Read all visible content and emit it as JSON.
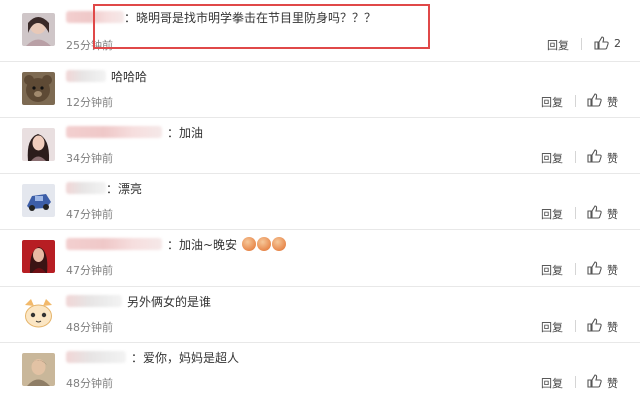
{
  "comments": [
    {
      "text": "：晓明哥是找市明学拳击在节目里防身吗？？？",
      "time": "25分钟前",
      "reply": "回复",
      "like": "2"
    },
    {
      "text": "哈哈哈",
      "time": "12分钟前",
      "reply": "回复",
      "like": "赞"
    },
    {
      "text": "：加油",
      "time": "34分钟前",
      "reply": "回复",
      "like": "赞"
    },
    {
      "text": "：漂亮",
      "time": "47分钟前",
      "reply": "回复",
      "like": "赞"
    },
    {
      "text": "：加油~晚安",
      "time": "47分钟前",
      "reply": "回复",
      "like": "赞"
    },
    {
      "text": "另外俩女的是谁",
      "time": "48分钟前",
      "reply": "回复",
      "like": "赞"
    },
    {
      "text": "：爱你，妈妈是超人",
      "time": "48分钟前",
      "reply": "回复",
      "like": "赞"
    }
  ],
  "icons": {
    "like": "thumbs-up-icon"
  },
  "colors": {
    "highlight_border": "#e04848",
    "time_text": "#808080"
  }
}
